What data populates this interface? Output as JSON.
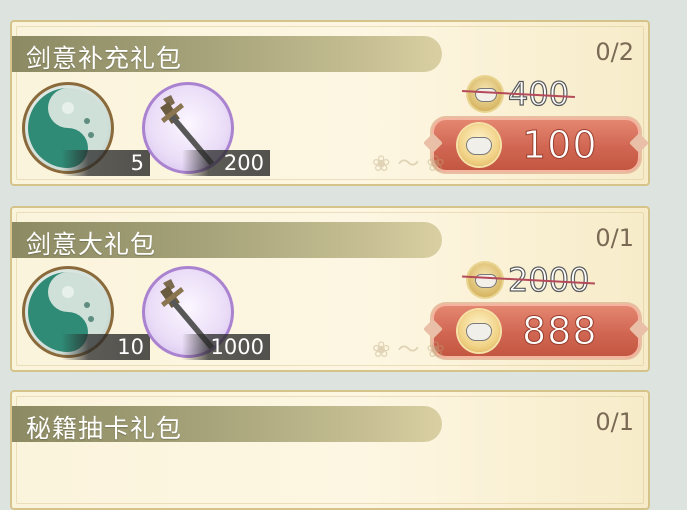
{
  "packs": [
    {
      "title": "剑意补充礼包",
      "count": "0/2",
      "items": [
        {
          "icon": "jade-token-icon",
          "qty": "5"
        },
        {
          "icon": "sword-icon",
          "qty": "200"
        }
      ],
      "old_price": "400",
      "price": "100"
    },
    {
      "title": "剑意大礼包",
      "count": "0/1",
      "items": [
        {
          "icon": "jade-token-icon",
          "qty": "10"
        },
        {
          "icon": "sword-icon",
          "qty": "1000"
        }
      ],
      "old_price": "2000",
      "price": "888"
    },
    {
      "title": "秘籍抽卡礼包",
      "count": "0/1"
    }
  ],
  "colors": {
    "title_bar": "#a6a37a",
    "buy_button": "#d06652",
    "panel_border": "#d6c38a",
    "strike_line": "#b44a5a"
  }
}
